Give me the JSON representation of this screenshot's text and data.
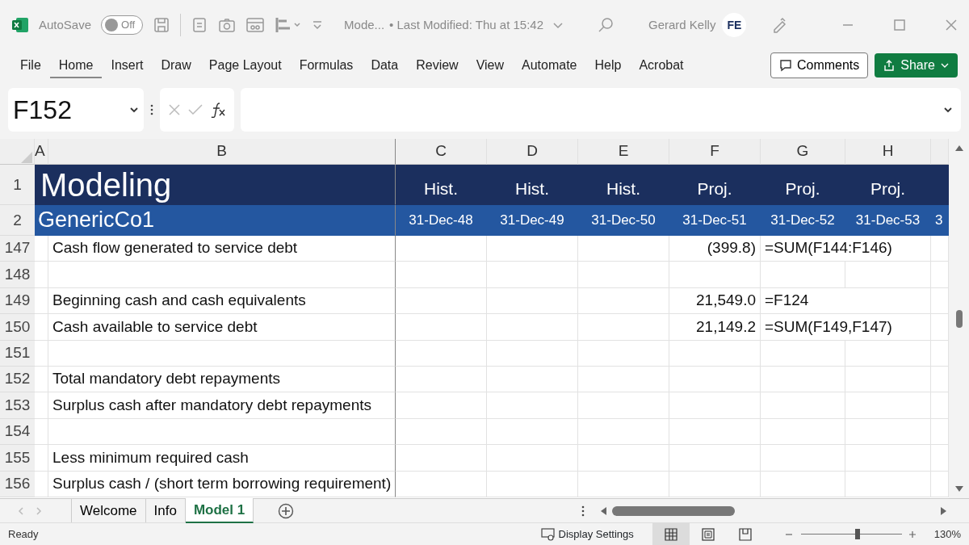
{
  "title_bar": {
    "autosave_label": "AutoSave",
    "autosave": {
      "on": false,
      "label": "Off"
    },
    "document": "Mode...",
    "modified": "• Last Modified: Thu at 15:42",
    "user": "Gerard Kelly",
    "avatar": "FE"
  },
  "ribbon_tabs": [
    {
      "label": "File",
      "selected": false
    },
    {
      "label": "Home",
      "selected": true
    },
    {
      "label": "Insert",
      "selected": false
    },
    {
      "label": "Draw",
      "selected": false
    },
    {
      "label": "Page Layout",
      "selected": false
    },
    {
      "label": "Formulas",
      "selected": false
    },
    {
      "label": "Data",
      "selected": false
    },
    {
      "label": "Review",
      "selected": false
    },
    {
      "label": "View",
      "selected": false
    },
    {
      "label": "Automate",
      "selected": false
    },
    {
      "label": "Help",
      "selected": false
    },
    {
      "label": "Acrobat",
      "selected": false
    }
  ],
  "ribbon_buttons": {
    "comments": "Comments",
    "share": "Share"
  },
  "formula_bar": {
    "name_box": "F152"
  },
  "columns": [
    "A",
    "B",
    "C",
    "D",
    "E",
    "F",
    "G",
    "H"
  ],
  "header_rows": [
    {
      "number": "1",
      "title": "Modeling",
      "cells": [
        "Hist.",
        "Hist.",
        "Hist.",
        "Proj.",
        "Proj.",
        "Proj."
      ]
    },
    {
      "number": "2",
      "title": "GenericCo1",
      "cells": [
        "31-Dec-48",
        "31-Dec-49",
        "31-Dec-50",
        "31-Dec-51",
        "31-Dec-52",
        "31-Dec-53",
        "3"
      ]
    }
  ],
  "rows": [
    {
      "number": "147",
      "label": "Cash flow generated to service debt",
      "cells": {
        "F": "(399.8)",
        "G": "=SUM(F144:F146)"
      }
    },
    {
      "number": "148"
    },
    {
      "number": "149",
      "label": "Beginning cash and cash equivalents",
      "cells": {
        "F": "21,549.0",
        "G": "=F124"
      }
    },
    {
      "number": "150",
      "label": "Cash available to service debt",
      "cells": {
        "F": "21,149.2",
        "G": "=SUM(F149,F147)"
      }
    },
    {
      "number": "151"
    },
    {
      "number": "152",
      "label": "Total mandatory debt repayments"
    },
    {
      "number": "153",
      "label": "Surplus cash after mandatory debt repayments"
    },
    {
      "number": "154"
    },
    {
      "number": "155",
      "label": "Less minimum required cash"
    },
    {
      "number": "156",
      "label": "Surplus cash / (short term borrowing requirement)"
    }
  ],
  "sheet_tabs": [
    {
      "label": "Welcome",
      "selected": false
    },
    {
      "label": "Info",
      "selected": false
    },
    {
      "label": "Model 1",
      "selected": true
    }
  ],
  "status_bar": {
    "status": "Ready",
    "display_settings": "Display Settings",
    "views": [
      {
        "kind": "normal",
        "selected": true
      },
      {
        "kind": "page-layout",
        "selected": false
      },
      {
        "kind": "page-break",
        "selected": false
      }
    ],
    "zoom": {
      "level": 0.56,
      "label": "130%"
    }
  }
}
